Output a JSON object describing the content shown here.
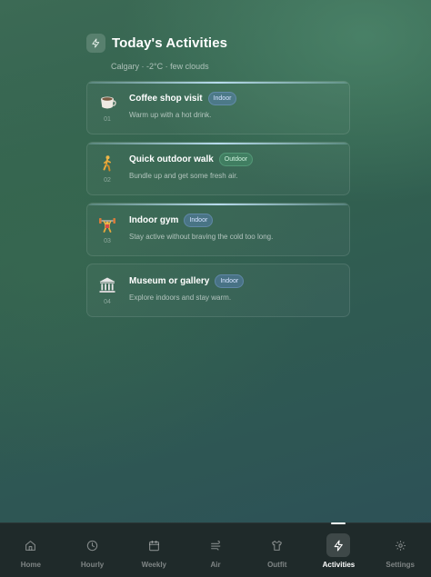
{
  "header": {
    "title": "Today's Activities",
    "subtitle": "Calgary · -2°C · few clouds",
    "icon": "bolt-icon"
  },
  "activities": [
    {
      "number": "01",
      "title": "Coffee shop visit",
      "badge": "Indoor",
      "type": "indoor",
      "description": "Warm up with a hot drink.",
      "icon": "coffee-cup-icon"
    },
    {
      "number": "02",
      "title": "Quick outdoor walk",
      "badge": "Outdoor",
      "type": "outdoor",
      "description": "Bundle up and get some fresh air.",
      "icon": "walking-person-icon"
    },
    {
      "number": "03",
      "title": "Indoor gym",
      "badge": "Indoor",
      "type": "indoor",
      "description": "Stay active without braving the cold too long.",
      "icon": "weightlifter-icon"
    },
    {
      "number": "04",
      "title": "Museum or gallery",
      "badge": "Indoor",
      "type": "indoor",
      "description": "Explore indoors and stay warm.",
      "icon": "museum-icon"
    }
  ],
  "tabs": [
    {
      "label": "Home",
      "icon": "home-icon",
      "active": false
    },
    {
      "label": "Hourly",
      "icon": "clock-icon",
      "active": false
    },
    {
      "label": "Weekly",
      "icon": "calendar-icon",
      "active": false
    },
    {
      "label": "Air",
      "icon": "wind-icon",
      "active": false
    },
    {
      "label": "Outfit",
      "icon": "shirt-icon",
      "active": false
    },
    {
      "label": "Activities",
      "icon": "bolt-icon",
      "active": true
    },
    {
      "label": "Settings",
      "icon": "gear-icon",
      "active": false
    }
  ],
  "colors": {
    "background_top": "#3c6a55",
    "background_bottom": "#2c4f58",
    "tabbar": "#1f2a2a",
    "indoor_badge": "#5a82be",
    "outdoor_badge": "#46966e"
  }
}
